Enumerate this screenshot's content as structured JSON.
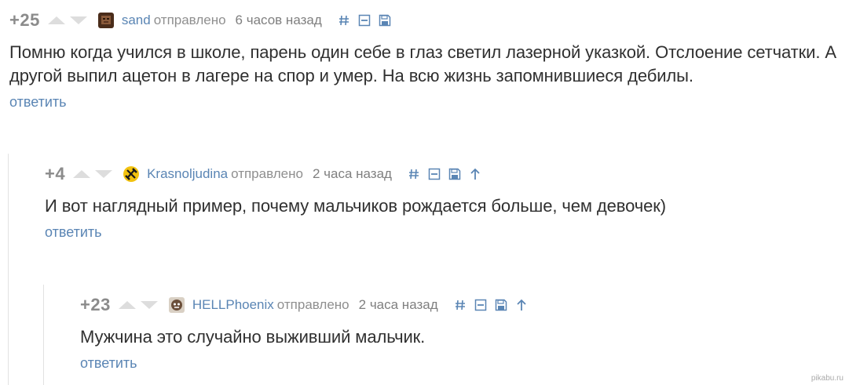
{
  "colors": {
    "link": "#5a85b4",
    "rating": "#8b8b8b",
    "meta": "#8f8f8f",
    "text": "#303030",
    "vote_arrow": "#dddddd"
  },
  "comments": [
    {
      "rating": "+25",
      "username": "sand",
      "sent_label": "отправлено",
      "time": "6 часов назад",
      "text": "Помню когда учился в школе, парень один себе в глаз светил лазерной указкой. Отслоение сетчатки. А другой выпил ацетон в лагере на спор и умер. На всю жизнь запомнившиеся дебилы.",
      "reply_label": "ответить",
      "actions": [
        "hash-icon",
        "collapse-icon",
        "save-icon"
      ]
    },
    {
      "rating": "+4",
      "username": "Krasnoljudina",
      "sent_label": "отправлено",
      "time": "2 часа назад",
      "text": "И вот наглядный пример, почему мальчиков рождается больше, чем девочек)",
      "reply_label": "ответить",
      "actions": [
        "hash-icon",
        "collapse-icon",
        "save-icon",
        "parent-arrow-icon"
      ]
    },
    {
      "rating": "+23",
      "username": "HELLPhoenix",
      "sent_label": "отправлено",
      "time": "2 часа назад",
      "text": "Мужчина это случайно выживший мальчик.",
      "reply_label": "ответить",
      "actions": [
        "hash-icon",
        "collapse-icon",
        "save-icon",
        "parent-arrow-icon"
      ]
    }
  ],
  "watermark": "pikabu.ru"
}
